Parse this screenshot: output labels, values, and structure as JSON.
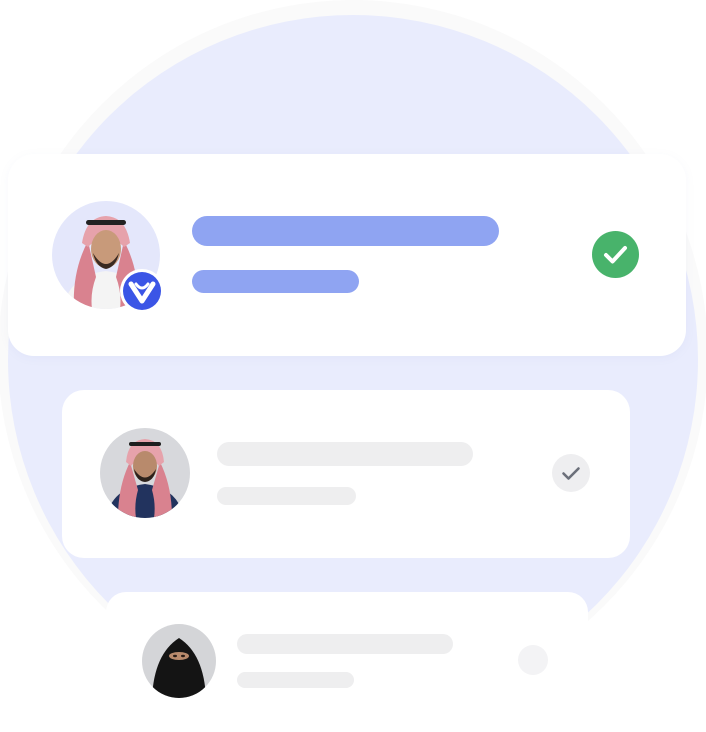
{
  "colors": {
    "background": "#ffffff",
    "outer_circle": "#fafafa",
    "inner_circle": "#e9ecfd",
    "card": "#ffffff",
    "accent_bar": "#8fa4f2",
    "placeholder_bar": "#eeeeef",
    "verified_green": "#48b36b",
    "check_grey": "#6b6f7a",
    "badge_blue": "#3b55e6"
  },
  "list": {
    "items": [
      {
        "avatar": "avatar-man-white-thobe-red-shemagh",
        "badge_icon": "verified-v-badge-icon",
        "status_icon": "check-circle-green-icon",
        "state": "selected"
      },
      {
        "avatar": "avatar-man-navy-thobe-red-shemagh",
        "status_icon": "check-circle-grey-icon",
        "state": "default"
      },
      {
        "avatar": "avatar-woman-niqab",
        "status_icon": "check-circle-grey-icon",
        "state": "partially-visible"
      }
    ]
  }
}
